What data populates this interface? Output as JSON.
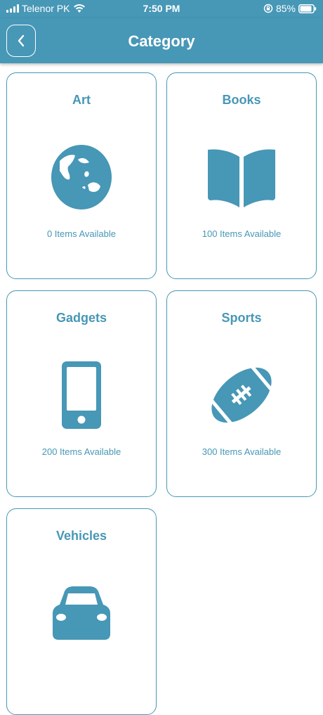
{
  "status_bar": {
    "carrier": "Telenor PK",
    "time": "7:50 PM",
    "battery": "85%"
  },
  "header": {
    "title": "Category"
  },
  "categories": [
    {
      "name": "Art",
      "count_text": "0 Items Available",
      "icon": "globe-icon"
    },
    {
      "name": "Books",
      "count_text": "100 Items Available",
      "icon": "book-icon"
    },
    {
      "name": "Gadgets",
      "count_text": "200 Items Available",
      "icon": "phone-icon"
    },
    {
      "name": "Sports",
      "count_text": "300 Items Available",
      "icon": "football-icon"
    },
    {
      "name": "Vehicles",
      "count_text": "",
      "icon": "car-icon"
    }
  ],
  "colors": {
    "primary": "#4797b6",
    "background": "#ffffff"
  }
}
